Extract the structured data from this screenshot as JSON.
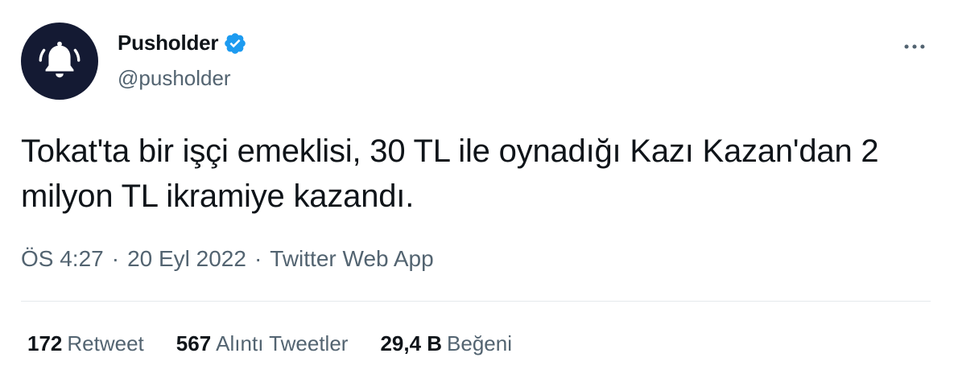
{
  "author": {
    "display_name": "Pusholder",
    "handle": "@pusholder",
    "verified": true,
    "avatar_icon": "bell-icon",
    "avatar_bg": "#141a33"
  },
  "tweet": {
    "text": "Tokat'ta bir işçi emeklisi, 30 TL ile oynadığı Kazı Kazan'dan 2 milyon TL ikramiye kazandı."
  },
  "meta": {
    "time": "ÖS 4:27",
    "sep1": "·",
    "date": "20 Eyl 2022",
    "sep2": "·",
    "source": "Twitter Web App"
  },
  "stats": {
    "retweets": {
      "count": "172",
      "label": "Retweet"
    },
    "quotes": {
      "count": "567",
      "label": "Alıntı Tweetler"
    },
    "likes": {
      "count": "29,4 B",
      "label": "Beğeni"
    }
  },
  "colors": {
    "verified_blue": "#1d9bf0",
    "secondary_text": "#536471",
    "primary_text": "#0f1419"
  },
  "icons": {
    "more": "more-horizontal-icon",
    "verified": "verified-badge-icon"
  }
}
